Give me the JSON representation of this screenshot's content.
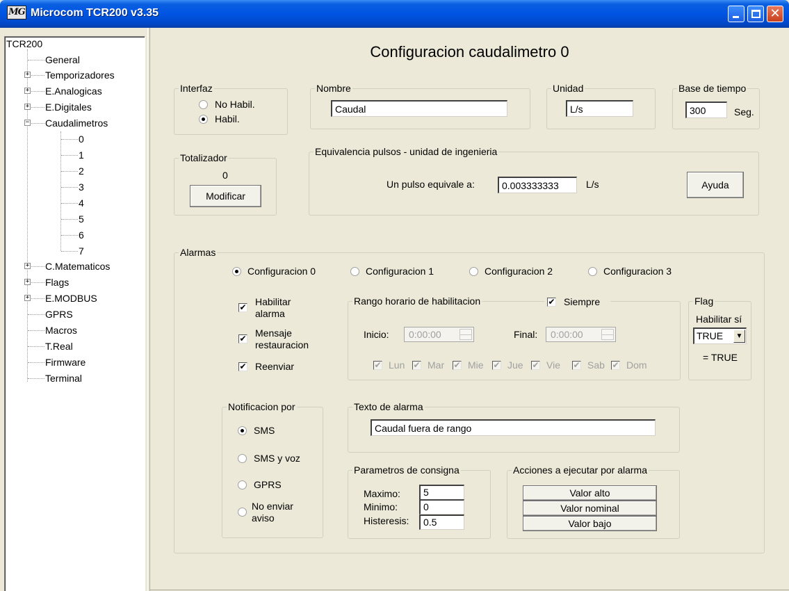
{
  "window": {
    "title": "Microcom TCR200 v3.35"
  },
  "tree": {
    "root": "TCR200",
    "items": [
      "General",
      "Temporizadores",
      "E.Analogicas",
      "E.Digitales",
      "Caudalimetros",
      "C.Matematicos",
      "Flags",
      "E.MODBUS",
      "GPRS",
      "Macros",
      "T.Real",
      "Firmware",
      "Terminal"
    ],
    "children": [
      "0",
      "1",
      "2",
      "3",
      "4",
      "5",
      "6",
      "7"
    ]
  },
  "page": {
    "title": "Configuracion caudalimetro 0"
  },
  "interfaz": {
    "legend": "Interfaz",
    "options": [
      "No Habil.",
      "Habil."
    ],
    "selected": "Habil."
  },
  "nombre": {
    "legend": "Nombre",
    "value": "Caudal"
  },
  "unidad": {
    "legend": "Unidad",
    "value": "L/s"
  },
  "base_tiempo": {
    "legend": "Base de tiempo",
    "value": "300",
    "unit": "Seg."
  },
  "totalizador": {
    "legend": "Totalizador",
    "value": "0",
    "button": "Modificar"
  },
  "equivalencia": {
    "legend": "Equivalencia pulsos - unidad de ingenieria",
    "label": "Un pulso equivale a:",
    "value": "0.003333333",
    "unit": "L/s",
    "help_button": "Ayuda"
  },
  "alarmas": {
    "legend": "Alarmas",
    "configs": [
      "Configuracion 0",
      "Configuracion 1",
      "Configuracion 2",
      "Configuracion 3"
    ],
    "selected_config": "Configuracion 0",
    "checks": {
      "habilitar_1": "Habilitar",
      "habilitar_2": "alarma",
      "mensaje_1": "Mensaje",
      "mensaje_2": "restauracion",
      "reenviar": "Reenviar"
    },
    "rango": {
      "legend": "Rango horario de habilitacion",
      "siempre": "Siempre",
      "inicio_label": "Inicio:",
      "inicio_value": "0:00:00",
      "final_label": "Final:",
      "final_value": "0:00:00",
      "days": [
        "Lun",
        "Mar",
        "Mie",
        "Jue",
        "Vie",
        "Sab",
        "Dom"
      ]
    },
    "flag": {
      "legend": "Flag",
      "label": "Habilitar sí",
      "value": "TRUE",
      "result": "= TRUE"
    },
    "notificacion": {
      "legend": "Notificacion por",
      "options": [
        "SMS",
        "SMS y voz",
        "GPRS"
      ],
      "no_enviar_1": "No enviar",
      "no_enviar_2": "aviso",
      "selected": "SMS"
    },
    "texto": {
      "legend": "Texto de alarma",
      "value": "Caudal fuera de rango"
    },
    "consigna": {
      "legend": "Parametros de consigna",
      "maximo_label": "Maximo:",
      "maximo": "5",
      "minimo_label": "Minimo:",
      "minimo": "0",
      "histeresis_label": "Histeresis:",
      "histeresis": "0.5"
    },
    "acciones": {
      "legend": "Acciones a ejecutar por alarma",
      "buttons": [
        "Valor alto",
        "Valor nominal",
        "Valor bajo"
      ]
    }
  }
}
